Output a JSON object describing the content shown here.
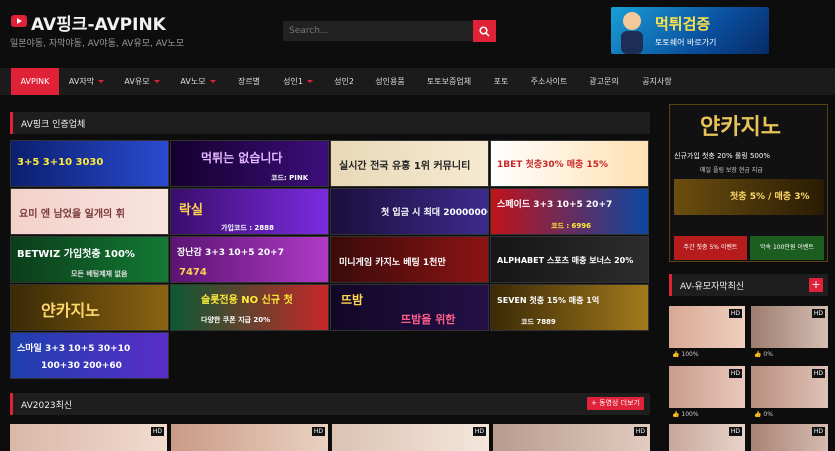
{
  "header": {
    "title": "AV핑크-AVPINK",
    "description": "일본야동, 자막야동, AV야동, AV유모, AV노모",
    "search_placeholder": "Search...",
    "top_banner": {
      "line1": "먹튀검증",
      "line2": "토토쉐어 바로가기"
    }
  },
  "nav": {
    "items": [
      {
        "label": "AVPINK",
        "active": true
      },
      {
        "label": "AV자막",
        "dropdown": true
      },
      {
        "label": "AV유모",
        "dropdown": true
      },
      {
        "label": "AV노모",
        "dropdown": true
      },
      {
        "label": "장르별"
      },
      {
        "label": "성인1",
        "dropdown": true
      },
      {
        "label": "성인2"
      },
      {
        "label": "성인용품"
      },
      {
        "label": "토토보증업체"
      },
      {
        "label": "포토"
      },
      {
        "label": "주소사이트"
      },
      {
        "label": "광고문의"
      },
      {
        "label": "공지사항"
      }
    ]
  },
  "main": {
    "partners_title": "AV핑크 인증업체",
    "banners": [
      {
        "text": "3+5 3+10 3030"
      },
      {
        "text": "먹튀는 없습니다",
        "sub": "코드: PINK"
      },
      {
        "text": "실시간 전국 유흥 1위 커뮤니티"
      },
      {
        "text": "1BET 첫충30% 매충 15%"
      },
      {
        "text": "요미 엔 남었을 일개의 휘"
      },
      {
        "text": "락실",
        "sub": "가입코드 : 2888"
      },
      {
        "text": "첫 입금 시 최대 2000000원"
      },
      {
        "text": "스페이드 3+3 10+5 20+7",
        "sub": "코드 : 6996"
      },
      {
        "text": "BETWIZ 가입첫충 100%",
        "sub": "모든 베팅제재 없음"
      },
      {
        "text": "장난감 3+3 10+5 20+7",
        "sub": "7474"
      },
      {
        "text": "미니게임 카지노 베팅 1천만"
      },
      {
        "text": "ALPHABET 스포츠 매충 보너스 20%"
      },
      {
        "text": "얀카지노"
      },
      {
        "text": "슬롯전용 NO 신규 첫",
        "sub": "다양한 쿠폰 지급 20%"
      },
      {
        "text": "뜨밤",
        "sub": "뜨밤을 위한"
      },
      {
        "text": "SEVEN 첫충 15% 매충 1억",
        "sub": "코드 7889"
      },
      {
        "text": "스마일 3+3 10+5 30+10",
        "sub": "100+30 200+60"
      }
    ],
    "latest_title": "AV2023최신",
    "latest_more": "+ 동영상 더보기"
  },
  "sidebar": {
    "ad": {
      "title": "얀카지노",
      "line1": "신규가입 첫충 20%  롤링 500%",
      "line2": "매일 플링 보장 현금 지급",
      "box1": "첫충 5% / 매충 3%",
      "bar": "주간 첫충 5% 이벤트",
      "bar2": "악속 100만원 이벤트"
    },
    "section_title": "AV-유모자막최신",
    "items": [
      {
        "pct": "100%"
      },
      {
        "pct": "0%"
      },
      {
        "pct": "100%"
      },
      {
        "pct": "0%"
      }
    ]
  }
}
